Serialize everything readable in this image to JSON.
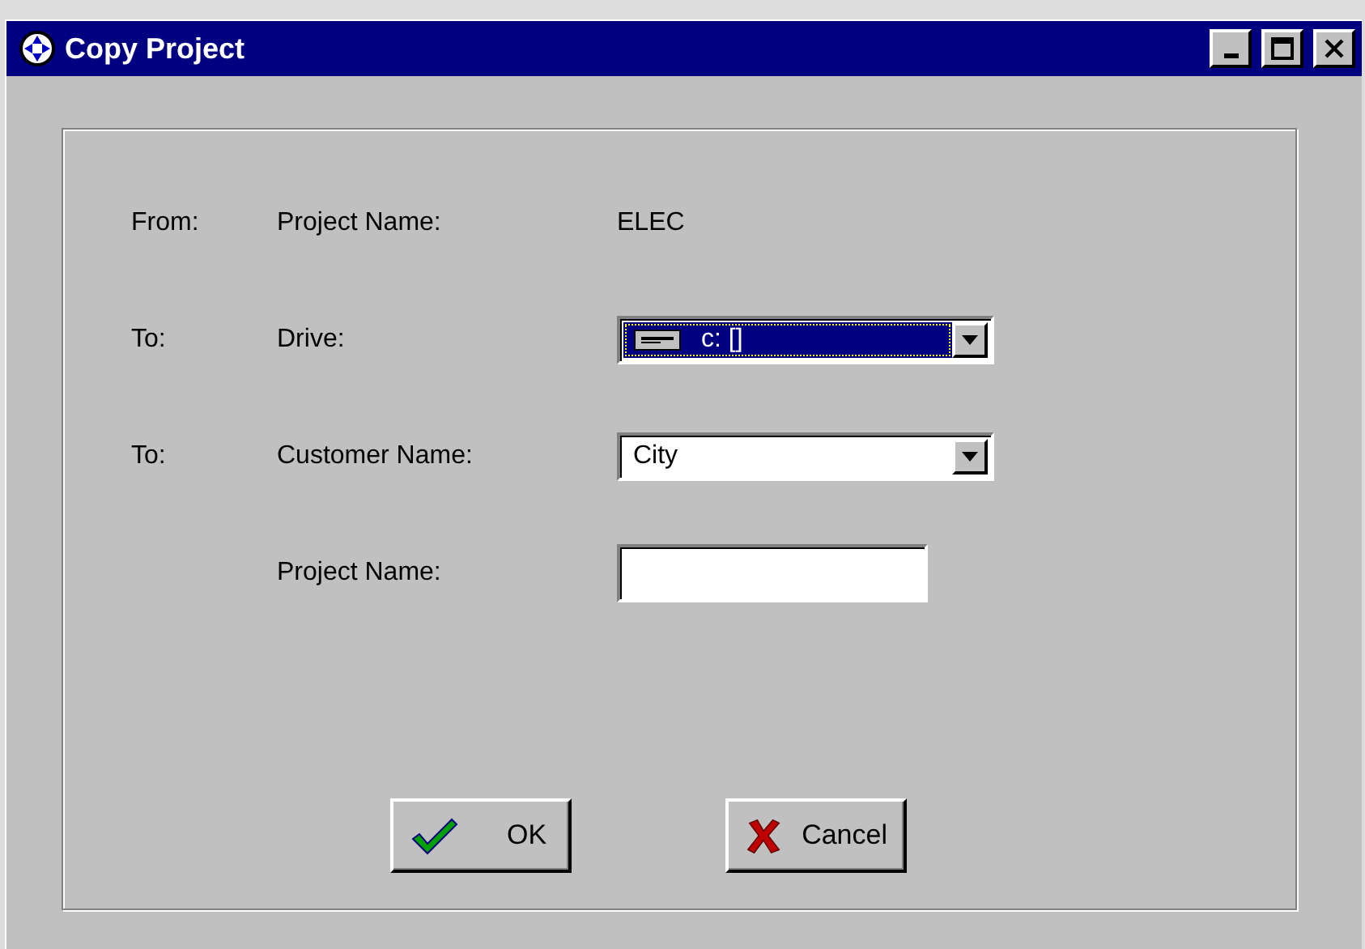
{
  "window": {
    "title": "Copy Project"
  },
  "rows": [
    {
      "prefix": "From:",
      "label": "Project Name:",
      "kind": "text",
      "value": "ELEC"
    },
    {
      "prefix": "To:",
      "label": "Drive:",
      "kind": "drive",
      "value": "c: []",
      "focused": true
    },
    {
      "prefix": "To:",
      "label": "Customer Name:",
      "kind": "combo",
      "value": "City",
      "focused": false
    },
    {
      "label": "Project Name:",
      "kind": "input"
    }
  ],
  "buttons": [
    {
      "kind": "ok",
      "label": "OK"
    },
    {
      "kind": "cancel",
      "label": "Cancel"
    }
  ]
}
